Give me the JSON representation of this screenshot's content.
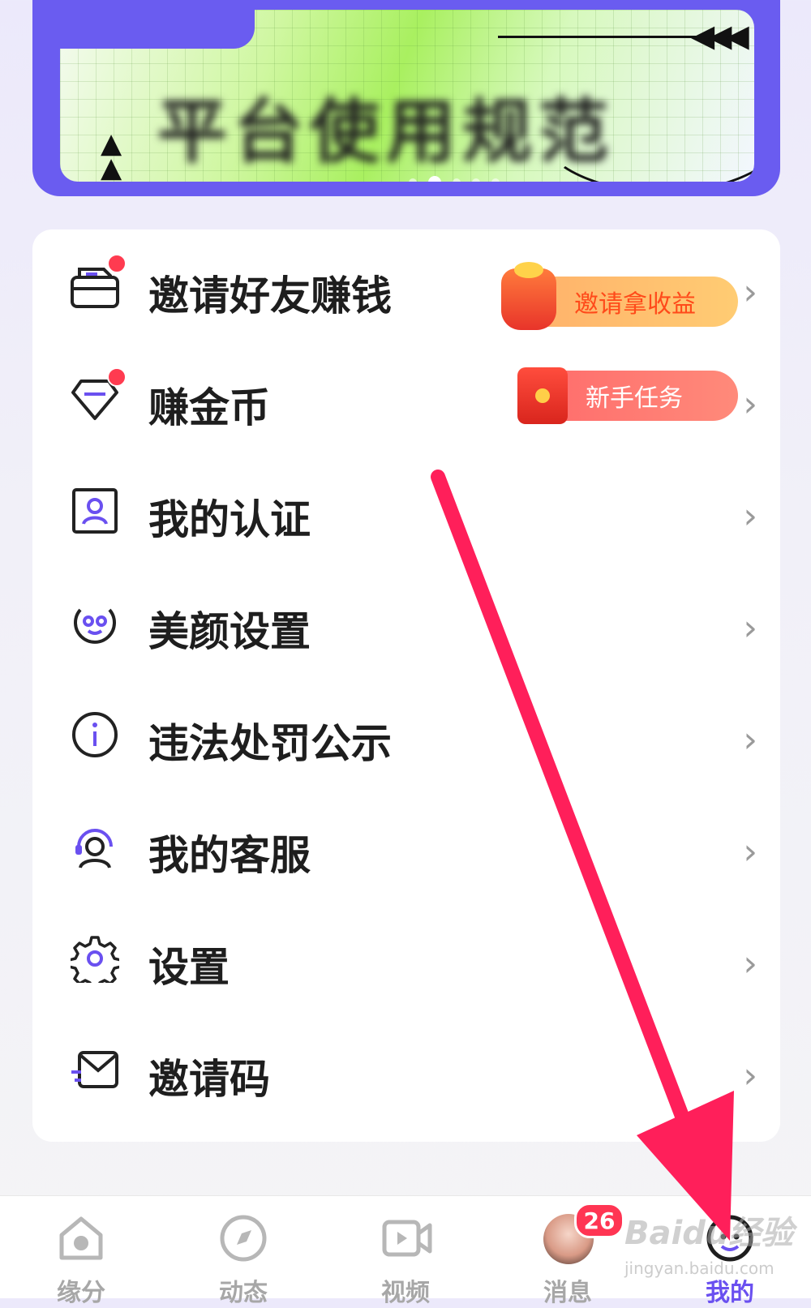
{
  "banner": {
    "title": "平台使用规范",
    "indicator_count": 5,
    "active_indicator": 2
  },
  "menu": {
    "items": [
      {
        "label": "邀请好友赚钱",
        "icon": "invite-envelope-icon",
        "has_dot": true,
        "tag": "邀请拿收益"
      },
      {
        "label": "赚金币",
        "icon": "diamond-icon",
        "has_dot": true,
        "tag": "新手任务"
      },
      {
        "label": "我的认证",
        "icon": "id-card-icon"
      },
      {
        "label": "美颜设置",
        "icon": "beauty-face-icon"
      },
      {
        "label": "违法处罚公示",
        "icon": "info-icon"
      },
      {
        "label": "我的客服",
        "icon": "headset-icon"
      },
      {
        "label": "设置",
        "icon": "gear-icon"
      },
      {
        "label": "邀请码",
        "icon": "mail-icon"
      }
    ],
    "chevron": "›"
  },
  "tabbar": {
    "tabs": [
      {
        "label": "缘分",
        "icon": "home-icon"
      },
      {
        "label": "动态",
        "icon": "compass-icon"
      },
      {
        "label": "视频",
        "icon": "video-icon"
      },
      {
        "label": "消息",
        "icon": "avatar",
        "badge": "26"
      },
      {
        "label": "我的",
        "icon": "profile-face-icon",
        "active": true
      }
    ]
  },
  "watermark": {
    "brand": "Baidu经验",
    "url": "jingyan.baidu.com"
  },
  "colors": {
    "accent": "#6a50f0",
    "badge": "#ff3553",
    "arrow": "#ff1f5a"
  }
}
